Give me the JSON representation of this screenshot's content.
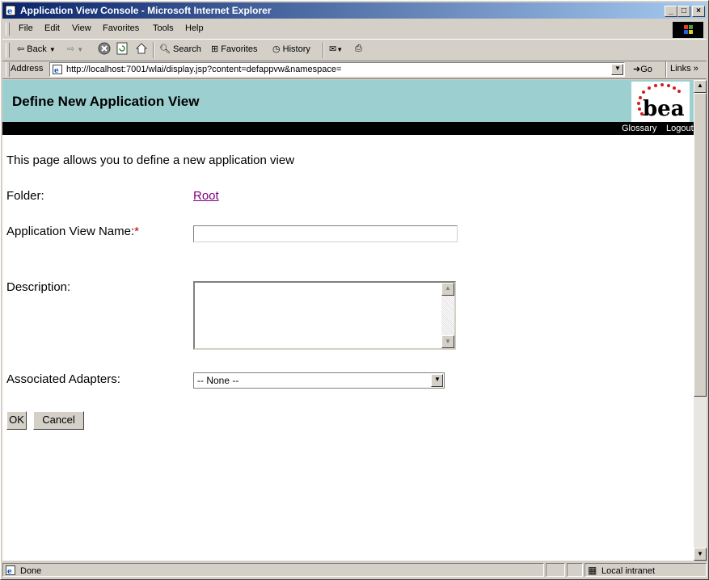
{
  "window": {
    "title": "Application View Console - Microsoft Internet Explorer",
    "minimize": "_",
    "maximize": "□",
    "close": "×"
  },
  "menu": {
    "items": [
      "File",
      "Edit",
      "View",
      "Favorites",
      "Tools",
      "Help"
    ]
  },
  "toolbar": {
    "back": "Back",
    "search": "Search",
    "favorites": "Favorites",
    "history": "History"
  },
  "address": {
    "label": "Address",
    "url": "http://localhost:7001/wlai/display.jsp?content=defappvw&namespace=",
    "go": "Go",
    "links": "Links"
  },
  "page": {
    "heading": "Define New Application View",
    "logo_text": "bea",
    "nav": [
      "Glossary",
      "Logout"
    ],
    "intro": "This page allows you to define a new application view",
    "folder_label": "Folder:",
    "folder_value": "Root",
    "name_label": "Application View Name:",
    "required_mark": "*",
    "description_label": "Description:",
    "adapters_label": "Associated Adapters:",
    "adapters_selected": "-- None --",
    "ok_button": "OK",
    "cancel_button": "Cancel"
  },
  "status": {
    "text": "Done",
    "zone": "Local intranet"
  },
  "colors": {
    "banner": "#9ccfcf",
    "title_bar": "#0a246a",
    "link_visited": "#800080",
    "required": "#c00000"
  }
}
